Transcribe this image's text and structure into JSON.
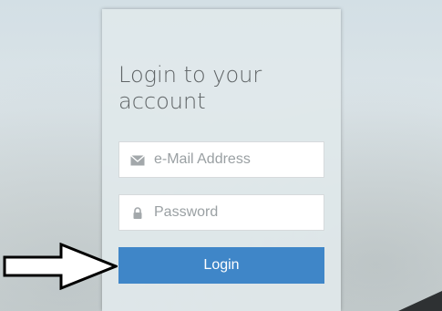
{
  "login": {
    "title": "Login to your account",
    "email": {
      "value": "",
      "placeholder": "e-Mail Address",
      "icon": "envelope-icon"
    },
    "password": {
      "value": "",
      "placeholder": "Password",
      "icon": "lock-icon"
    },
    "submit_label": "Login"
  },
  "annotation": {
    "icon": "right-arrow-icon"
  },
  "colors": {
    "button": "#3f86c8",
    "card": "#e0e8eb",
    "title": "#5f6466",
    "icon": "#9aa0a3"
  }
}
